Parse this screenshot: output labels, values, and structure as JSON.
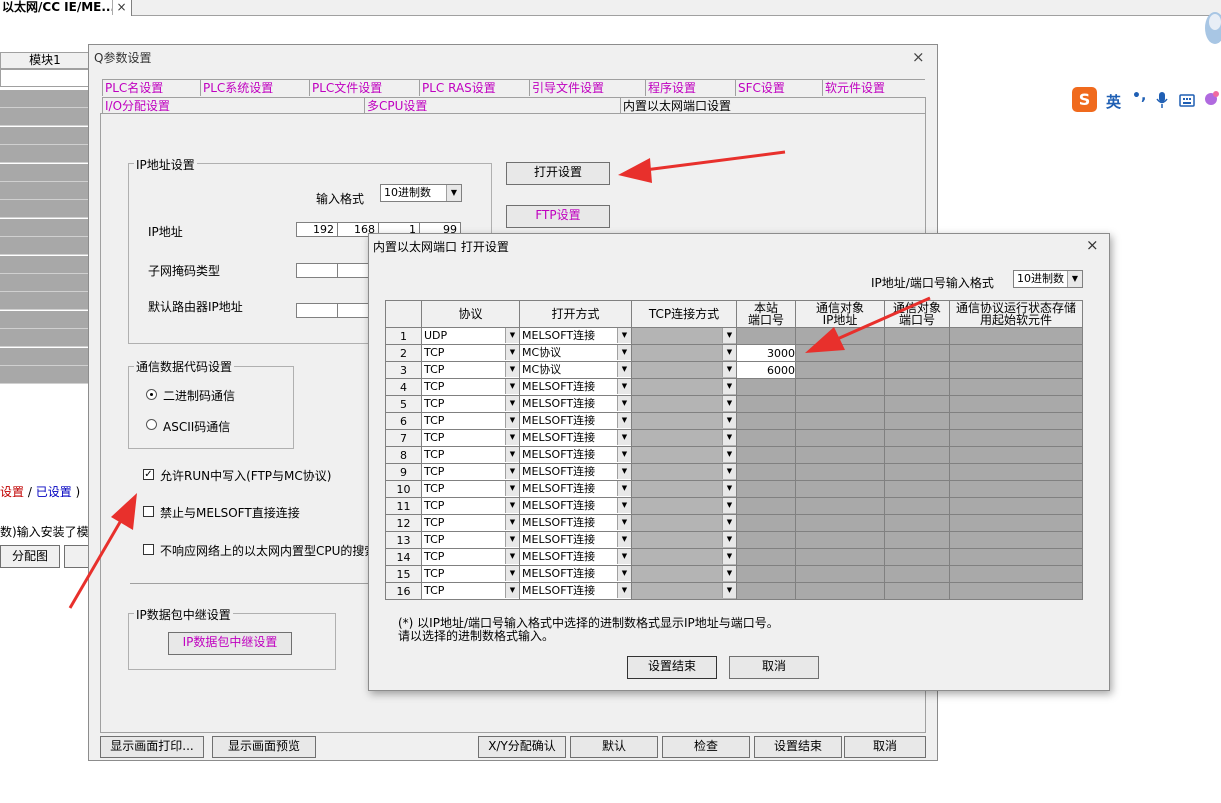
{
  "top_tab": {
    "title": "以太网/CC IE/ME...",
    "close": "×"
  },
  "bg": {
    "module_header": "模块1",
    "set_status": {
      "part1": "设置",
      "sep": " / ",
      "part2": "已设置",
      "tail": " )"
    },
    "hint": "数)输入安装了模",
    "button": "分配图"
  },
  "qdialog": {
    "title": "Q参数设置",
    "close": "×",
    "tabs_row1": [
      "PLC名设置",
      "PLC系统设置",
      "PLC文件设置",
      "PLC RAS设置",
      "引导文件设置",
      "程序设置",
      "SFC设置",
      "软元件设置"
    ],
    "tabs_row2": [
      "I/O分配设置",
      "多CPU设置",
      "内置以太网端口设置"
    ],
    "ip_group": {
      "label": "IP地址设置",
      "input_format_label": "输入格式",
      "input_format_value": "10进制数",
      "ip_label": "IP地址",
      "ip": [
        "192",
        "168",
        "1",
        "99"
      ],
      "subnet_label": "子网掩码类型",
      "gateway_label": "默认路由器IP地址"
    },
    "open_settings_button": "打开设置",
    "ftp_button": "FTP设置",
    "code_group": {
      "label": "通信数据代码设置",
      "binary": "二进制码通信",
      "ascii": "ASCII码通信"
    },
    "allow_run_write": "允许RUN中写入(FTP与MC协议)",
    "disable_melsoft": "禁止与MELSOFT直接连接",
    "no_respond_search": "不响应网络上的以太网内置型CPU的搜索",
    "relay_group": {
      "label": "IP数据包中继设置",
      "button": "IP数据包中继设置"
    },
    "footer_buttons": [
      "显示画面打印...",
      "显示画面预览",
      "X/Y分配确认",
      "默认",
      "检查",
      "设置结束",
      "取消"
    ]
  },
  "open_dialog": {
    "title": "内置以太网端口 打开设置",
    "close": "×",
    "format_label": "IP地址/端口号输入格式",
    "format_value": "10进制数",
    "columns": [
      "协议",
      "打开方式",
      "TCP连接方式",
      "本站\n端口号",
      "通信对象\nIP地址",
      "通信对象\n端口号",
      "通信协议运行状态存储\n用起始软元件"
    ],
    "rows": [
      {
        "no": "1",
        "protocol": "UDP",
        "open": "MELSOFT连接",
        "port": ""
      },
      {
        "no": "2",
        "protocol": "TCP",
        "open": "MC协议",
        "port": "3000"
      },
      {
        "no": "3",
        "protocol": "TCP",
        "open": "MC协议",
        "port": "6000"
      },
      {
        "no": "4",
        "protocol": "TCP",
        "open": "MELSOFT连接",
        "port": ""
      },
      {
        "no": "5",
        "protocol": "TCP",
        "open": "MELSOFT连接",
        "port": ""
      },
      {
        "no": "6",
        "protocol": "TCP",
        "open": "MELSOFT连接",
        "port": ""
      },
      {
        "no": "7",
        "protocol": "TCP",
        "open": "MELSOFT连接",
        "port": ""
      },
      {
        "no": "8",
        "protocol": "TCP",
        "open": "MELSOFT连接",
        "port": ""
      },
      {
        "no": "9",
        "protocol": "TCP",
        "open": "MELSOFT连接",
        "port": ""
      },
      {
        "no": "10",
        "protocol": "TCP",
        "open": "MELSOFT连接",
        "port": ""
      },
      {
        "no": "11",
        "protocol": "TCP",
        "open": "MELSOFT连接",
        "port": ""
      },
      {
        "no": "12",
        "protocol": "TCP",
        "open": "MELSOFT连接",
        "port": ""
      },
      {
        "no": "13",
        "protocol": "TCP",
        "open": "MELSOFT连接",
        "port": ""
      },
      {
        "no": "14",
        "protocol": "TCP",
        "open": "MELSOFT连接",
        "port": ""
      },
      {
        "no": "15",
        "protocol": "TCP",
        "open": "MELSOFT连接",
        "port": ""
      },
      {
        "no": "16",
        "protocol": "TCP",
        "open": "MELSOFT连接",
        "port": ""
      }
    ],
    "footnote1": "(*) 以IP地址/端口号输入格式中选择的进制数格式显示IP地址与端口号。",
    "footnote2": "请以选择的进制数格式输入。",
    "ok_button": "设置结束",
    "cancel_button": "取消"
  },
  "ime": {
    "logo": "S",
    "lang": "英",
    "punct": "•,",
    "mic_icon": "mic-icon",
    "keyboard_icon": "keyboard-icon"
  },
  "colors": {
    "tab_magenta": "#c000c0",
    "arrow_red": "#e8302c",
    "grid_gray": "#a9a9a9",
    "ime_orange": "#f06a1d"
  }
}
